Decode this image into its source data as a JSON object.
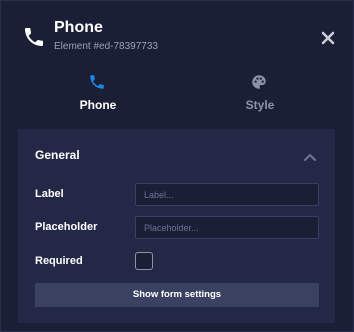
{
  "header": {
    "title": "Phone",
    "subtitle": "Element #ed-78397733",
    "icon": "phone-icon",
    "close_icon": "close-icon"
  },
  "tabs": [
    {
      "label": "Phone",
      "icon": "phone-icon",
      "active": true,
      "icon_color": "#1e88e5"
    },
    {
      "label": "Style",
      "icon": "palette-icon",
      "active": false
    }
  ],
  "section": {
    "title": "General",
    "expanded": true,
    "fields": {
      "label": {
        "label": "Label",
        "value": "",
        "placeholder": "Label..."
      },
      "placeholder": {
        "label": "Placeholder",
        "value": "",
        "placeholder": "Placeholder..."
      },
      "required": {
        "label": "Required",
        "checked": false
      }
    },
    "button_label": "Show form settings"
  },
  "colors": {
    "background": "#1b1f36",
    "section_background": "#232847",
    "accent": "#1e88e5",
    "button_background": "#3b4261"
  }
}
